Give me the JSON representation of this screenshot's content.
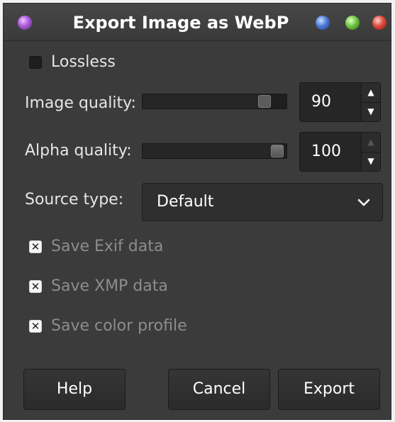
{
  "window": {
    "title": "Export Image as WebP"
  },
  "options": {
    "lossless_label": "Lossless",
    "lossless_checked": false,
    "image_quality_label": "Image quality:",
    "image_quality_value": "90",
    "image_quality_level": 0.9,
    "alpha_quality_label": "Alpha quality:",
    "alpha_quality_value": "100",
    "alpha_quality_level": 1.0,
    "source_type_label": "Source type:",
    "source_type_value": "Default",
    "save_exif_label": "Save Exif data",
    "save_xmp_label": "Save XMP data",
    "save_color_profile_label": "Save color profile"
  },
  "buttons": {
    "help": "Help",
    "cancel": "Cancel",
    "export": "Export"
  },
  "icons": {
    "title_icon": "gimp-purple-orb-icon",
    "window_buttons": [
      "minimize-blue-icon",
      "maximize-green-icon",
      "close-red-icon"
    ],
    "check_mark": "x-check-icon",
    "chevron": "chevron-down-icon",
    "spin_up": "arrow-up-icon",
    "spin_down": "arrow-down-icon"
  },
  "colors": {
    "background": "#3b3b3b",
    "field": "#262626",
    "text": "#e6e6e6",
    "disabled_text": "#8d8d8d"
  }
}
